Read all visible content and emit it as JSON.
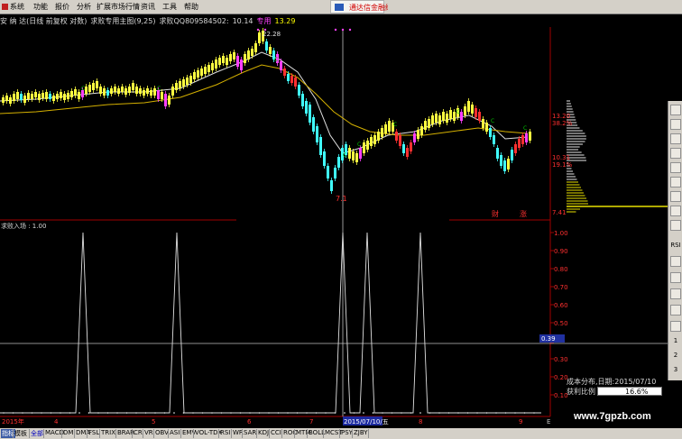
{
  "menu": [
    {
      "label": "系统"
    },
    {
      "label": "功能"
    },
    {
      "label": "报价"
    },
    {
      "label": "分析"
    },
    {
      "label": "扩展市场行情"
    },
    {
      "label": "资讯"
    },
    {
      "label": "工具"
    },
    {
      "label": "帮助"
    }
  ],
  "banner": {
    "label": "通达信金融终"
  },
  "info": {
    "title": "安 纳 达(日线 前复权 对数)",
    "indicator": "求败专用主图(9,25)",
    "contact": "求败QQ809584502:",
    "val1": "10.14",
    "label_special": "专用",
    "val2": "13.29"
  },
  "price_axis": {
    "high_price": "13.20",
    "high_pct": "38.2%",
    "mid_price": "10.31",
    "mid_pct": "19.1%",
    "low_price": "7.41"
  },
  "price_annotations": {
    "peak": "22.28",
    "trough": "7.1",
    "marker_a": "C",
    "tag_cai": "财",
    "tag_zhang": "涨"
  },
  "indicator_panel": {
    "title": "求败入场 : 1.00",
    "y_ticks": [
      "1.00",
      "0.90",
      "0.80",
      "0.70",
      "0.60",
      "0.50",
      "0.39",
      "0.30",
      "0.20",
      "0.10"
    ],
    "cursor_value": "0.39",
    "peaks_date_index": [
      0,
      1,
      2,
      3,
      4
    ]
  },
  "time_axis": {
    "labels": [
      "2015年",
      "4",
      "5",
      "6",
      "7",
      "2015/07/10/五",
      "8",
      "9",
      "E"
    ]
  },
  "cost_panel": {
    "title": "成本分布,日期:",
    "date": "2015/07/10",
    "ratio_label": "获利比例",
    "ratio_value": "16.6%"
  },
  "toolbar_right": [
    "RSI",
    "1",
    "2",
    "3"
  ],
  "tabs": [
    {
      "label": "指标",
      "state": "active"
    },
    {
      "label": "模板",
      "state": ""
    },
    {
      "label": "全部",
      "state": "sel"
    },
    {
      "label": "MACD",
      "state": ""
    },
    {
      "label": "DMI",
      "state": ""
    },
    {
      "label": "DMA",
      "state": ""
    },
    {
      "label": "FSL",
      "state": ""
    },
    {
      "label": "TRIX",
      "state": ""
    },
    {
      "label": "BRAR",
      "state": ""
    },
    {
      "label": "CR",
      "state": ""
    },
    {
      "label": "VR",
      "state": ""
    },
    {
      "label": "OBV",
      "state": ""
    },
    {
      "label": "ASI",
      "state": ""
    },
    {
      "label": "EMV",
      "state": ""
    },
    {
      "label": "VOL-TDX",
      "state": ""
    },
    {
      "label": "RSI",
      "state": ""
    },
    {
      "label": "WR",
      "state": ""
    },
    {
      "label": "SAR",
      "state": ""
    },
    {
      "label": "KDJ",
      "state": ""
    },
    {
      "label": "CCI",
      "state": ""
    },
    {
      "label": "ROC",
      "state": ""
    },
    {
      "label": "MTM",
      "state": ""
    },
    {
      "label": "BOLL",
      "state": ""
    },
    {
      "label": "MCST",
      "state": ""
    },
    {
      "label": "PSY",
      "state": ""
    },
    {
      "label": "ZJBY",
      "state": ""
    }
  ],
  "watermark": "www.7gpzb.com",
  "colors": {
    "up_candle": "#ffff40",
    "down_candle": "#40ffff",
    "magenta_candle": "#ff40ff",
    "red_candle": "#ff3030",
    "ma_short": "#e0e0e0",
    "ma_long": "#d4b000",
    "grid_red": "#a00000",
    "cost_yellow": "#e8e000"
  }
}
